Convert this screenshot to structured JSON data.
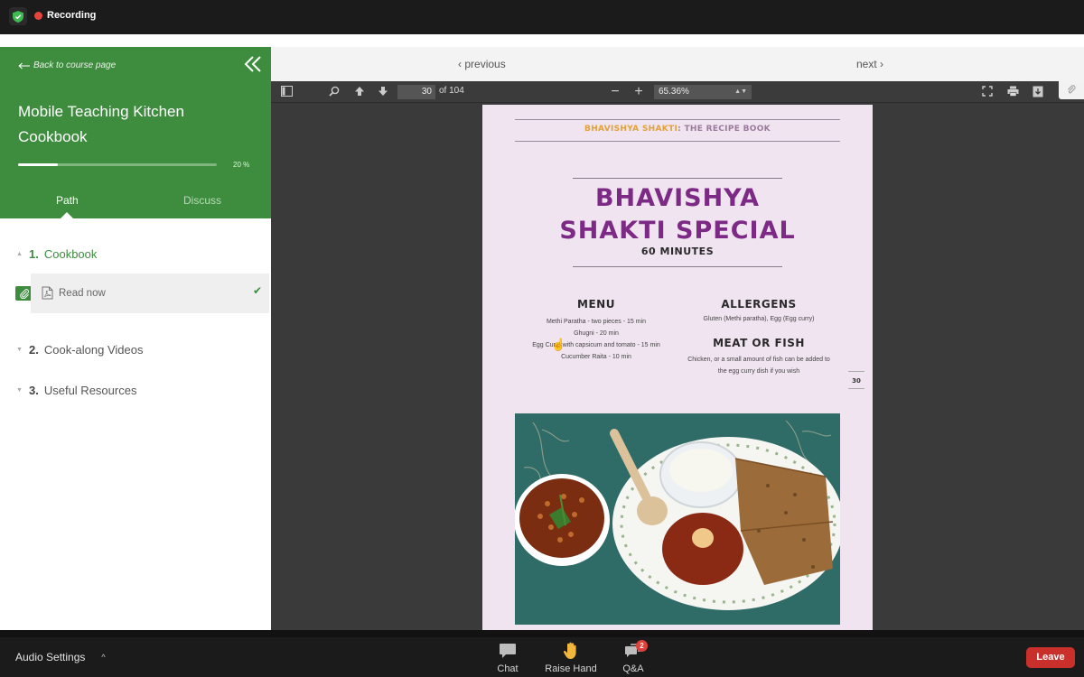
{
  "top_bar": {
    "recording_label": "Recording"
  },
  "sidebar": {
    "back_link": "Back to course page",
    "course_title": "Mobile Teaching Kitchen Cookbook",
    "progress_percent": 20,
    "progress_label": "20 %",
    "tabs": [
      {
        "label": "Path",
        "active": true
      },
      {
        "label": "Discuss",
        "active": false
      }
    ],
    "sections": [
      {
        "number": "1.",
        "label": "Cookbook",
        "expanded": true,
        "lessons": [
          {
            "label": "Read now",
            "completed": true
          }
        ]
      },
      {
        "number": "2.",
        "label": "Cook-along Videos",
        "expanded": false
      },
      {
        "number": "3.",
        "label": "Useful Resources",
        "expanded": false
      }
    ]
  },
  "viewer": {
    "prev_label": "previous",
    "next_label": "next",
    "toolbar": {
      "current_page": "30",
      "total_pages": "of 104",
      "zoom": "65.36%"
    },
    "page": {
      "header_brand": "BHAVISHYA SHAKTI",
      "header_rest": ": THE RECIPE BOOK",
      "title_line1": "BHAVISHYA",
      "title_line2": "SHAKTI SPECIAL",
      "duration": "60 MINUTES",
      "menu_heading": "MENU",
      "menu_items": [
        "Methi Paratha - two pieces - 15 min",
        "Ghugni - 20 min",
        "Egg Curry with capsicum and tomato - 15 min",
        "Cucumber Raita - 10 min"
      ],
      "allergens_heading": "ALLERGENS",
      "allergens_text": "Gluten (Methi paratha), Egg (Egg curry)",
      "meat_heading": "MEAT OR FISH",
      "meat_text": "Chicken, or a small amount of fish can be added to the egg curry dish if you wish",
      "page_number": "30"
    }
  },
  "bottom_bar": {
    "audio_settings": "Audio Settings",
    "chat": "Chat",
    "raise_hand": "Raise Hand",
    "qa": "Q&A",
    "qa_badge": "2",
    "leave": "Leave"
  },
  "colors": {
    "brand_green": "#3e8c3e",
    "title_purple": "#7d2a86",
    "header_orange": "#e3a13a",
    "leave_red": "#c9302c",
    "recording_red": "#e5453c"
  }
}
